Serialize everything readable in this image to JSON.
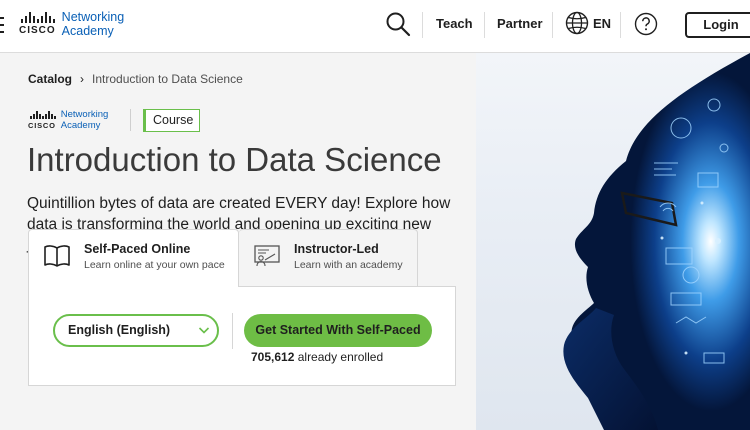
{
  "header": {
    "logo": {
      "brand": "CISCO",
      "line1": "Networking",
      "line2": "Academy"
    },
    "nav": {
      "teach": "Teach",
      "partner": "Partner",
      "language": "EN",
      "login": "Login"
    }
  },
  "breadcrumb": {
    "items": [
      "Catalog",
      "Introduction to Data Science"
    ]
  },
  "course": {
    "logo": {
      "brand": "CISCO",
      "line1": "Networking",
      "line2": "Academy"
    },
    "badge": "Course",
    "title": "Introduction to Data Science",
    "description": "Quintillion bytes of data are created EVERY day! Explore how data is transforming the world and opening up exciting new jobs."
  },
  "tabs": [
    {
      "title": "Self-Paced Online",
      "subtitle": "Learn online at your own pace",
      "icon": "book-icon",
      "active": true
    },
    {
      "title": "Instructor-Led",
      "subtitle": "Learn with an academy",
      "icon": "classroom-icon",
      "active": false
    }
  ],
  "enroll": {
    "language_selected": "English (English)",
    "cta": "Get Started With Self-Paced",
    "enrolled_count": "705,612",
    "enrolled_suffix": " already enrolled"
  },
  "colors": {
    "accent_green": "#6ebd45",
    "link_blue": "#0a60b6",
    "hero_glow": "#5fb8ff"
  }
}
